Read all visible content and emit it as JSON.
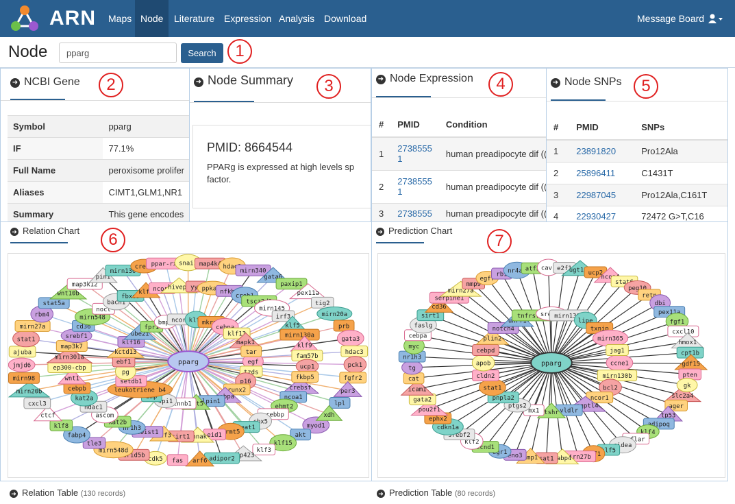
{
  "app": {
    "brand": "ARN",
    "nav": [
      "Maps",
      "Node",
      "Literature",
      "Expression",
      "Analysis",
      "Download"
    ],
    "active_nav": "Node",
    "message_board": "Message Board",
    "user_icon": "user-icon"
  },
  "search": {
    "title": "Node",
    "value": "pparg",
    "button": "Search"
  },
  "annotations": [
    "1",
    "2",
    "3",
    "4",
    "5",
    "6",
    "7"
  ],
  "ncbi": {
    "title": "NCBI Gene",
    "rows": [
      {
        "k": "Symbol",
        "v": "pparg"
      },
      {
        "k": "IF",
        "v": "77.1%"
      },
      {
        "k": "Full Name",
        "v": "peroxisome prolifer"
      },
      {
        "k": "Aliases",
        "v": "CIMT1,GLM1,NR1"
      },
      {
        "k": "Summary",
        "v": "This gene encodes"
      }
    ]
  },
  "summary": {
    "title": "Node Summary",
    "pmid": "PMID: 8664544",
    "text": "PPARg is expressed at high levels sp factor."
  },
  "expression": {
    "title": "Node Expression",
    "headers": [
      "#",
      "PMID",
      "Condition"
    ],
    "rows": [
      {
        "n": "1",
        "pmid": "2738555\n1",
        "cond": "human preadipocyte dif (("
      },
      {
        "n": "2",
        "pmid": "2738555\n1",
        "cond": "human preadipocyte dif (("
      },
      {
        "n": "3",
        "pmid": "2738555",
        "cond": "human preadipocyte dif (("
      }
    ]
  },
  "snps": {
    "title": "Node SNPs",
    "headers": [
      "#",
      "PMID",
      "SNPs"
    ],
    "rows": [
      {
        "n": "1",
        "pmid": "23891820",
        "snp": "Pro12Ala"
      },
      {
        "n": "2",
        "pmid": "25896411",
        "snp": "C1431T"
      },
      {
        "n": "3",
        "pmid": "22987045",
        "snp": "Pro12Ala,C161T"
      },
      {
        "n": "4",
        "pmid": "22930427",
        "snp": "72472 G>T,C16"
      }
    ]
  },
  "relation_chart": {
    "title": "Relation Chart",
    "center": "pparg",
    "nodes": [
      "egf",
      "tzds",
      "p16",
      "runx2",
      "gabpa",
      "lpin1",
      "kat5",
      "ctnnb1",
      "spi1",
      "bmp",
      "leukotriene b4",
      "setdb1",
      "pg",
      "ebf1",
      "kctd13",
      "klf16",
      "ube2i",
      "fpr1",
      "bmp2",
      "ncor1",
      "klf6",
      "mkrn1",
      "cebpa",
      "klf13",
      "mapk1",
      "tar",
      "crebsf",
      "ncoa1",
      "ehmt2",
      "crebbp",
      "cbx5",
      "neat1",
      "prmt5",
      "eid1",
      "ahnak",
      "sirt1",
      "atf3",
      "twist1",
      "nr1h3",
      "kat2b",
      "ascom",
      "hdac1",
      "kat2a",
      "cebpb",
      "wnt1",
      "ep300-cbp",
      "mirn301a",
      "map3k7",
      "srebf1",
      "cd36",
      "mirn548",
      "noct",
      "bach1",
      "fbxo9",
      "klf2",
      "ncor2",
      "hivep2",
      "yy1",
      "ppkaca",
      "nfkb1",
      "creb1",
      "tscz2d3",
      "mirn145",
      "irf3",
      "klf5",
      "mirn130a",
      "klf9",
      "fam57b",
      "ucp1",
      "fkbp5",
      "myod1",
      "akt",
      "klf15",
      "klf3",
      "zfp423",
      "adipor2",
      "arf6",
      "fas",
      "cdk5",
      "arid5b",
      "mirn548d",
      "tle3",
      "fabp4",
      "klf8",
      "ctcf",
      "cxcl3",
      "mirn20b",
      "mirn98",
      "jmjd6",
      "ajuba",
      "stat1",
      "mirn27a",
      "rbm4",
      "stat5a",
      "wnt10b",
      "map3k12",
      "pin1",
      "mirn130",
      "creb3",
      "ppar-rxr",
      "snai1",
      "map4k4",
      "hdac9",
      "mirn340",
      "gata6",
      "paxip1",
      "pex11a",
      "tig2",
      "mirn20a",
      "prb",
      "gata3",
      "hdac3",
      "pck1",
      "fgfr2",
      "per3",
      "lpl",
      "xdh"
    ]
  },
  "prediction_chart": {
    "title": "Prediction Chart",
    "center": "pparg",
    "nodes": [
      "ccne1",
      "mirn130b",
      "bcl2",
      "ncor1",
      "angptl4",
      "vldlr",
      "tshr",
      "mx1",
      "ptgs2",
      "pnpla2",
      "stat1",
      "cldn2",
      "apob",
      "cebpd",
      "plin2",
      "notch4",
      "uhrf1",
      "tnfrsf11b",
      "srebf1",
      "mirn130a",
      "lipe",
      "txnip",
      "mirn365",
      "jag1",
      "slc2a4",
      "ager",
      "tp53",
      "adipoq",
      "klf4",
      "cflar",
      "cidea",
      "klf5",
      "csf1",
      "mirn27b",
      "fabp4",
      "sat1",
      "mmp1",
      "eno3",
      "egr1",
      "ccnd1",
      "klf2",
      "srebf2",
      "cdkn1a",
      "ephx2",
      "pou2f1",
      "gata2",
      "icam1",
      "cat",
      "tg",
      "nr1h3",
      "myc",
      "cebpa",
      "faslg",
      "sirt1",
      "cd36",
      "serpine1",
      "mirn27a",
      "mmp9",
      "egfr",
      "rb1",
      "nr4a3",
      "atf3",
      "cav1",
      "e2f1",
      "ugt1a9",
      "ucp2",
      "ncoa4",
      "stat6",
      "peg10",
      "retn",
      "dbi",
      "pex11a",
      "fgf1",
      "cxcl10",
      "hmox1",
      "cpt1b",
      "gdf15",
      "pten",
      "gk"
    ]
  },
  "relation_table": {
    "title": "Relation Table",
    "records": "(130 records)"
  },
  "prediction_table": {
    "title": "Prediction Table",
    "records": "(80 records)"
  },
  "colors": {
    "nav": "#2a5f8f",
    "nav_active": "#1f4a72",
    "panel_border": "#b8cfe6",
    "annotation": "#e02020",
    "link": "#2a6aa8"
  }
}
